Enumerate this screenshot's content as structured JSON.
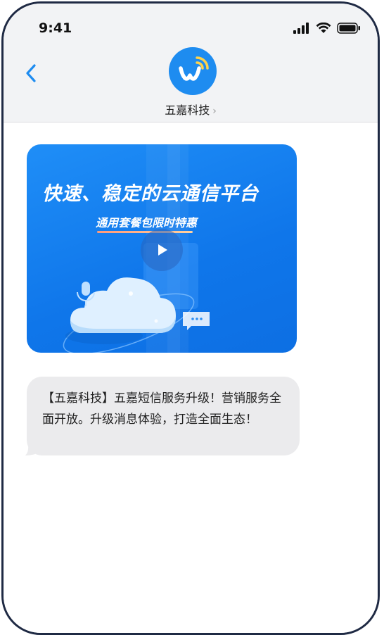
{
  "status_bar": {
    "time": "9:41"
  },
  "header": {
    "contact_name": "五嘉科技",
    "contact_chevron": "›",
    "back_icon": "chevron-left-icon",
    "avatar_icon": "wifi-w-logo"
  },
  "messages": [
    {
      "type": "media",
      "title": "快速、稳定的云通信平台",
      "subtitle": "通用套餐包限时特惠"
    },
    {
      "type": "text",
      "text": "【五嘉科技】五嘉短信服务升级！营销服务全面开放。升级消息体验，打造全面生态！"
    }
  ],
  "colors": {
    "accent": "#1e8cf0",
    "bubble_bg": "#ebebed",
    "header_bg": "#f2f3f5"
  }
}
